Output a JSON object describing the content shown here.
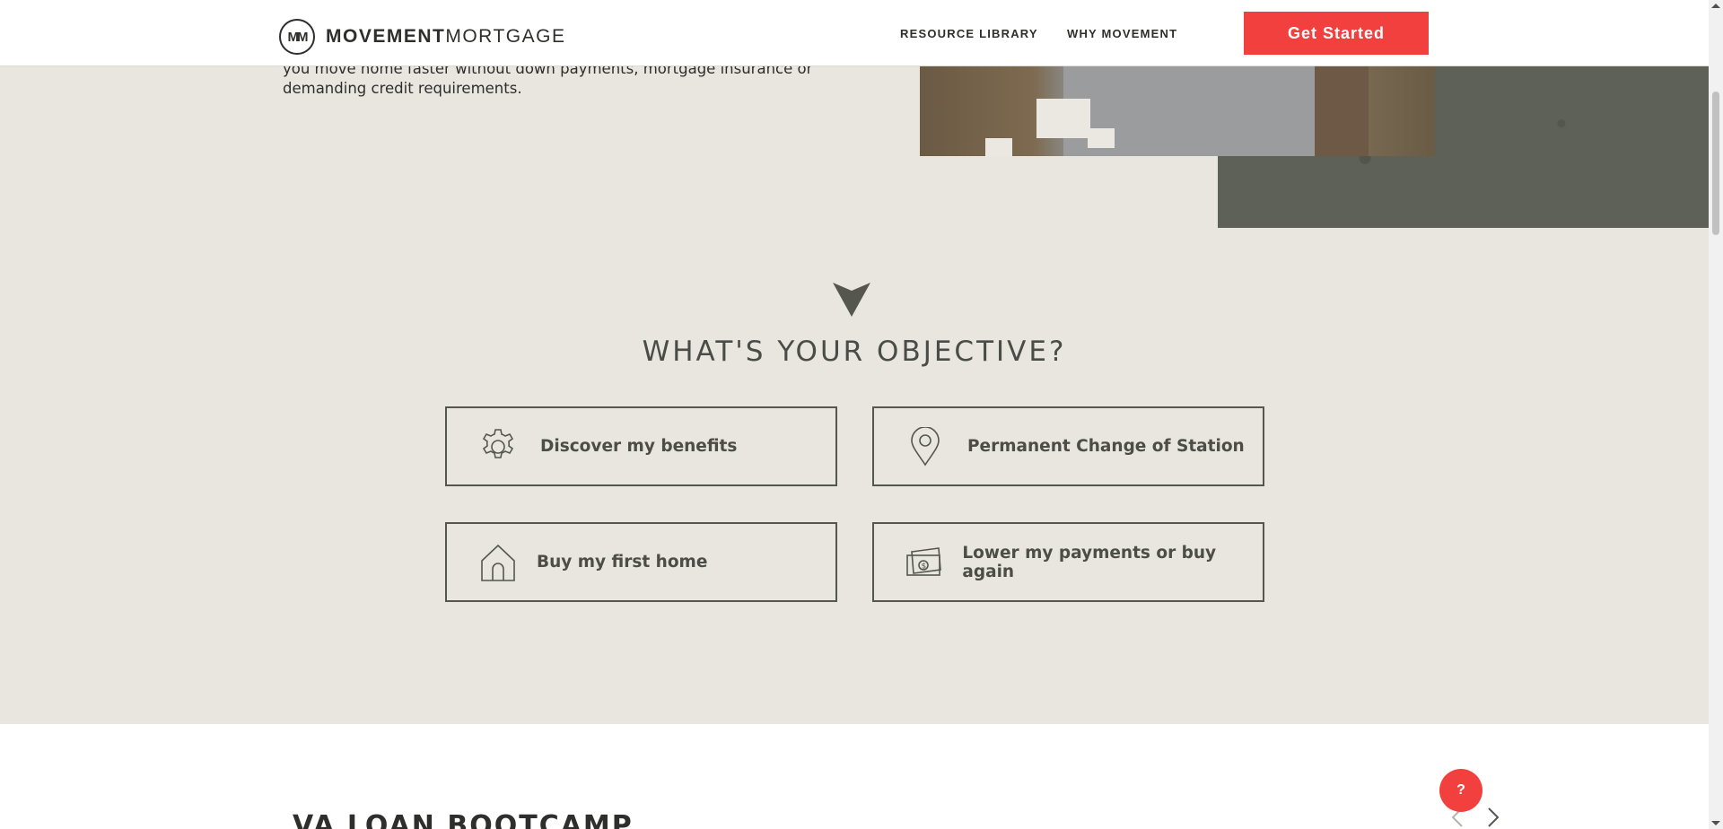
{
  "header": {
    "logo_mark": "MM",
    "logo_bold": "MOVEMENT",
    "logo_light": "MORTGAGE",
    "nav": [
      {
        "label": "RESOURCE LIBRARY"
      },
      {
        "label": "WHY MOVEMENT"
      }
    ],
    "cta_label": "Get Started"
  },
  "hero": {
    "body_text": "you move home faster without down payments, mortgage insurance or demanding credit requirements."
  },
  "objective": {
    "title": "WHAT'S YOUR OBJECTIVE?",
    "cards": [
      {
        "label": "Discover my benefits",
        "icon": "gear-icon"
      },
      {
        "label": "Permanent Change of Station",
        "icon": "location-pin-icon"
      },
      {
        "label": "Buy my first home",
        "icon": "house-icon"
      },
      {
        "label": "Lower my payments or buy again",
        "icon": "money-icon"
      }
    ]
  },
  "bootcamp": {
    "title": "VA LOAN BOOTCAMP"
  },
  "help": {
    "label": "?"
  },
  "colors": {
    "accent": "#f2403f",
    "background": "#e9e5df",
    "olive": "#5d6157",
    "text": "#2e2e2c"
  }
}
